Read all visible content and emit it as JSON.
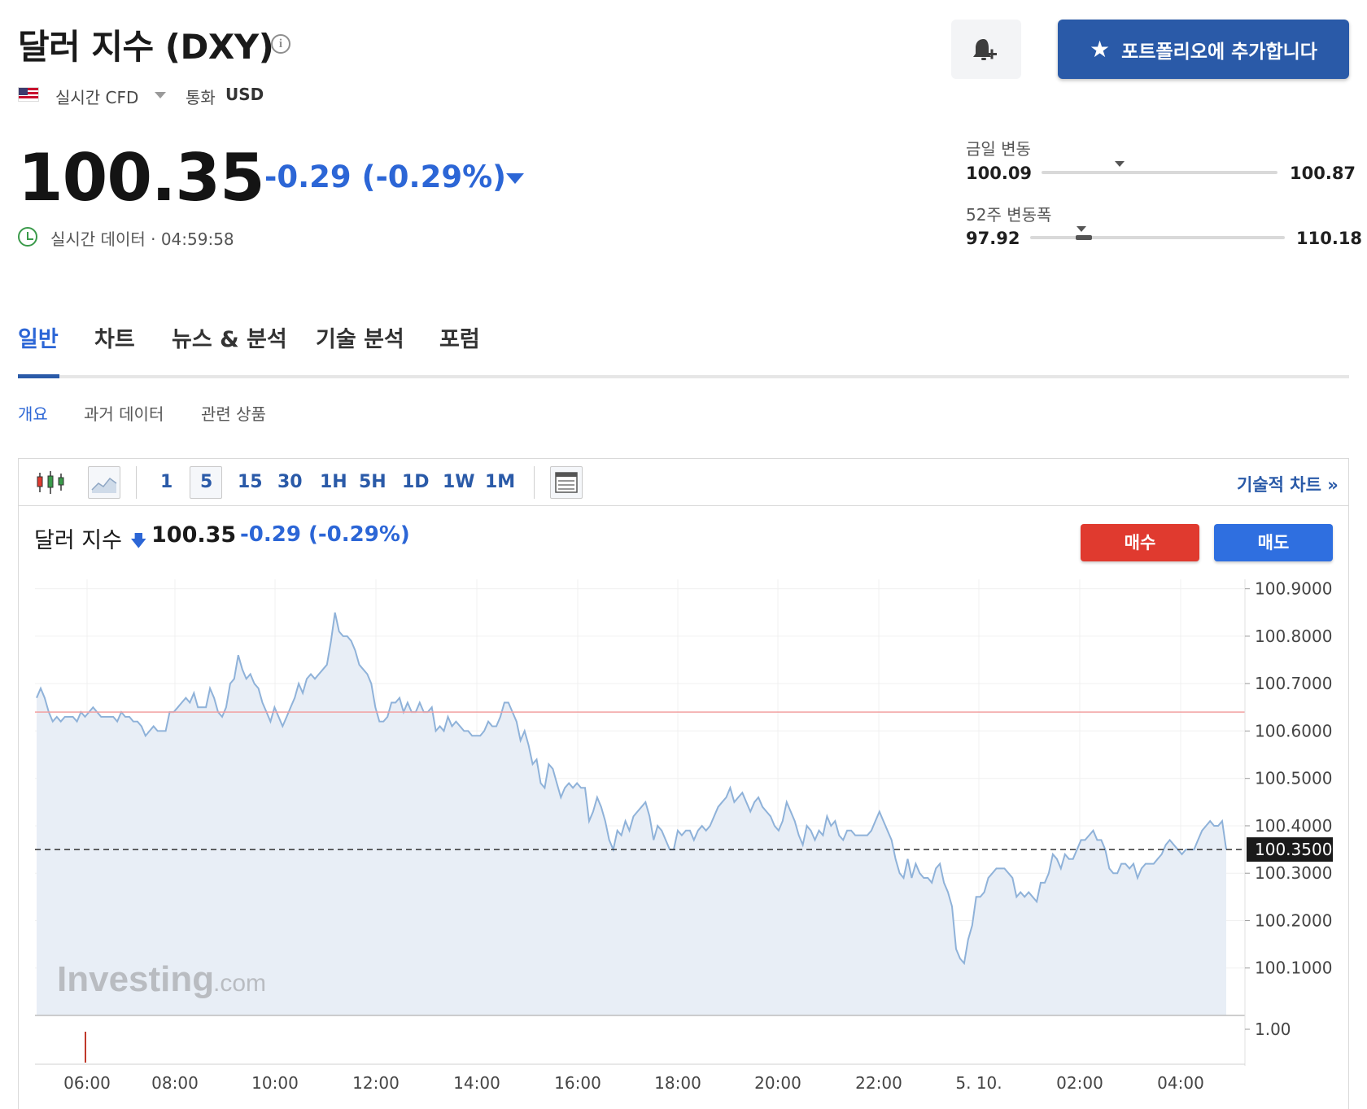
{
  "header": {
    "title": "달러 지수 (DXY)",
    "info_icon": "info-icon",
    "market_type": "실시간 CFD",
    "currency_label": "통화",
    "currency": "USD",
    "bell_icon": "bell-plus-icon",
    "portfolio_button": "포트폴리오에 추가합니다",
    "price": "100.35",
    "change": "-0.29 (-0.29%)",
    "live_label": "실시간 데이터 · 04:59:58"
  },
  "ranges": {
    "daily": {
      "label": "금일 변동",
      "low": "100.09",
      "high": "100.87",
      "current_fraction": 0.33
    },
    "week52": {
      "label": "52주 변동폭",
      "low": "97.92",
      "high": "110.18",
      "current_fraction": 0.2
    }
  },
  "tabs": [
    {
      "label": "일반",
      "active": true
    },
    {
      "label": "차트",
      "active": false
    },
    {
      "label": "뉴스 & 분석",
      "active": false
    },
    {
      "label": "기술 분석",
      "active": false
    },
    {
      "label": "포럼",
      "active": false
    }
  ],
  "subtabs": [
    {
      "label": "개요",
      "active": true
    },
    {
      "label": "과거 데이터",
      "active": false
    },
    {
      "label": "관련 상품",
      "active": false
    }
  ],
  "toolbar": {
    "intervals": [
      "1",
      "5",
      "15",
      "30",
      "1H",
      "5H",
      "1D",
      "1W",
      "1M"
    ],
    "selected_interval": "5",
    "tech_chart_label": "기술적 차트 »"
  },
  "chart_header": {
    "name": "달러 지수",
    "price": "100.35",
    "change": "-0.29 (-0.29%)",
    "buy_label": "매수",
    "sell_label": "매도"
  },
  "colors": {
    "accent": "#2a5aa8",
    "negative": "#2c66d6",
    "buy": "#e03a2f",
    "sell": "#2f6fe0",
    "line": "#8fb2d9",
    "area": "#e8eef6"
  },
  "chart_data": {
    "type": "area",
    "x_ticks": [
      "06:00",
      "08:00",
      "10:00",
      "12:00",
      "14:00",
      "16:00",
      "18:00",
      "20:00",
      "22:00",
      "5. 10.",
      "02:00",
      "04:00"
    ],
    "y_ticks": [
      "100.9000",
      "100.8000",
      "100.7000",
      "100.6000",
      "100.5000",
      "100.4000",
      "100.3000",
      "100.2000",
      "100.1000"
    ],
    "y_tick_values": [
      100.9,
      100.8,
      100.7,
      100.6,
      100.5,
      100.4,
      100.3,
      100.2,
      100.1
    ],
    "ylim": [
      100.0,
      100.92
    ],
    "current_label": "100.3500",
    "current_value": 100.35,
    "previous_close": 100.64,
    "volume_label": "1.00",
    "watermark": "Investing",
    "watermark_suffix": ".com",
    "start_time": "05:00",
    "interval_minutes": 5,
    "values": [
      100.67,
      100.69,
      100.67,
      100.64,
      100.62,
      100.63,
      100.62,
      100.63,
      100.63,
      100.63,
      100.62,
      100.64,
      100.63,
      100.64,
      100.65,
      100.64,
      100.63,
      100.63,
      100.63,
      100.63,
      100.62,
      100.64,
      100.63,
      100.63,
      100.62,
      100.62,
      100.61,
      100.59,
      100.6,
      100.61,
      100.6,
      100.6,
      100.6,
      100.64,
      100.64,
      100.65,
      100.66,
      100.67,
      100.66,
      100.68,
      100.65,
      100.65,
      100.65,
      100.69,
      100.67,
      100.64,
      100.63,
      100.65,
      100.7,
      100.71,
      100.76,
      100.73,
      100.71,
      100.72,
      100.7,
      100.69,
      100.66,
      100.64,
      100.62,
      100.65,
      100.63,
      100.61,
      100.63,
      100.65,
      100.67,
      100.7,
      100.68,
      100.71,
      100.72,
      100.71,
      100.72,
      100.73,
      100.74,
      100.79,
      100.85,
      100.81,
      100.8,
      100.8,
      100.79,
      100.77,
      100.74,
      100.73,
      100.72,
      100.7,
      100.65,
      100.62,
      100.62,
      100.63,
      100.66,
      100.66,
      100.67,
      100.64,
      100.66,
      100.64,
      100.64,
      100.66,
      100.64,
      100.64,
      100.65,
      100.6,
      100.61,
      100.6,
      100.63,
      100.61,
      100.62,
      100.61,
      100.6,
      100.6,
      100.59,
      100.59,
      100.59,
      100.6,
      100.62,
      100.61,
      100.61,
      100.63,
      100.66,
      100.66,
      100.64,
      100.62,
      100.58,
      100.6,
      100.57,
      100.53,
      100.54,
      100.49,
      100.48,
      100.53,
      100.52,
      100.49,
      100.46,
      100.48,
      100.49,
      100.48,
      100.49,
      100.48,
      100.48,
      100.41,
      100.43,
      100.46,
      100.44,
      100.41,
      100.37,
      100.35,
      100.39,
      100.38,
      100.41,
      100.39,
      100.42,
      100.43,
      100.44,
      100.45,
      100.42,
      100.37,
      100.4,
      100.39,
      100.37,
      100.35,
      100.35,
      100.39,
      100.38,
      100.39,
      100.39,
      100.37,
      100.39,
      100.4,
      100.39,
      100.4,
      100.42,
      100.44,
      100.45,
      100.46,
      100.48,
      100.45,
      100.46,
      100.47,
      100.45,
      100.43,
      100.45,
      100.46,
      100.44,
      100.43,
      100.42,
      100.4,
      100.39,
      100.41,
      100.45,
      100.43,
      100.41,
      100.38,
      100.36,
      100.4,
      100.39,
      100.37,
      100.39,
      100.38,
      100.42,
      100.4,
      100.41,
      100.38,
      100.37,
      100.39,
      100.39,
      100.38,
      100.38,
      100.38,
      100.38,
      100.39,
      100.41,
      100.43,
      100.41,
      100.39,
      100.37,
      100.33,
      100.3,
      100.29,
      100.33,
      100.29,
      100.32,
      100.3,
      100.29,
      100.29,
      100.28,
      100.31,
      100.32,
      100.28,
      100.26,
      100.23,
      100.14,
      100.12,
      100.11,
      100.16,
      100.19,
      100.25,
      100.25,
      100.26,
      100.29,
      100.3,
      100.31,
      100.31,
      100.31,
      100.3,
      100.29,
      100.25,
      100.26,
      100.25,
      100.26,
      100.25,
      100.24,
      100.28,
      100.28,
      100.3,
      100.34,
      100.33,
      100.31,
      100.34,
      100.33,
      100.33,
      100.35,
      100.37,
      100.37,
      100.38,
      100.39,
      100.37,
      100.37,
      100.35,
      100.31,
      100.3,
      100.3,
      100.32,
      100.32,
      100.31,
      100.32,
      100.29,
      100.31,
      100.32,
      100.32,
      100.32,
      100.33,
      100.34,
      100.36,
      100.37,
      100.36,
      100.35,
      100.34,
      100.35,
      100.35,
      100.35,
      100.37,
      100.39,
      100.4,
      100.41,
      100.4,
      100.4,
      100.41,
      100.35
    ]
  }
}
